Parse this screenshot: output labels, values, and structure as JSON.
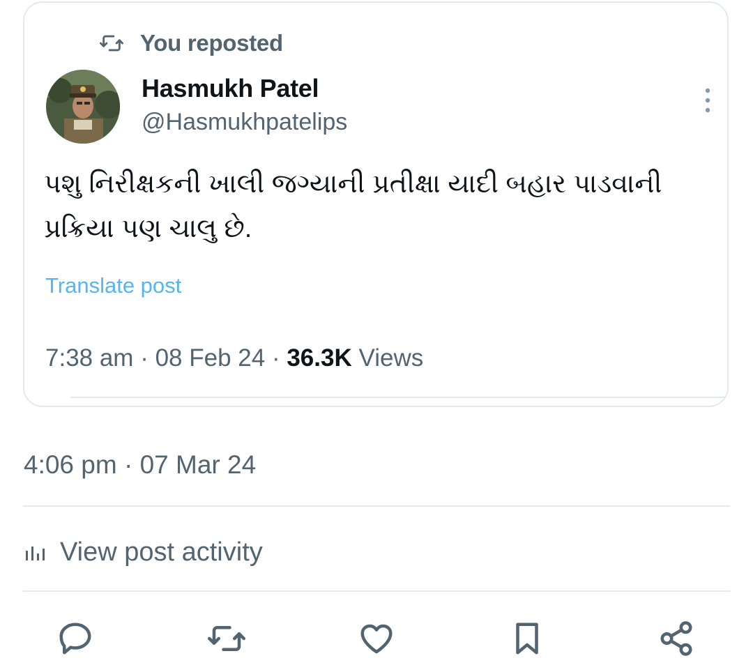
{
  "repost": {
    "label": "You reposted",
    "icon": "repost-icon"
  },
  "post": {
    "author": {
      "name": "Hasmukh Patel",
      "handle": "@Hasmukhpatelips",
      "avatar": "avatar-photo-officer-in-uniform"
    },
    "text": "પશુ નિરીક્ષકની ખાલી જગ્યાની પ્રતીક્ષા યાદી બહાર પાડવાની પ્રક્રિયા પણ ચાલુ છે.",
    "translate_label": "Translate post",
    "time": "7:38 am",
    "date": "08 Feb 24",
    "views_count": "36.3K",
    "views_label": "Views",
    "separator": "·"
  },
  "repost_meta": {
    "time": "4:06 pm",
    "separator": "·",
    "date": "07 Mar 24"
  },
  "activity": {
    "label": "View post activity",
    "icon": "analytics-icon"
  },
  "actions": [
    {
      "name": "reply",
      "icon": "reply-icon"
    },
    {
      "name": "repost",
      "icon": "repost-icon"
    },
    {
      "name": "like",
      "icon": "heart-icon"
    },
    {
      "name": "bookmark",
      "icon": "bookmark-icon"
    },
    {
      "name": "share",
      "icon": "share-icon"
    }
  ],
  "colors": {
    "text_primary": "#0f1419",
    "text_secondary": "#536471",
    "link": "#1d9bf0",
    "border": "#e6e9ec"
  }
}
